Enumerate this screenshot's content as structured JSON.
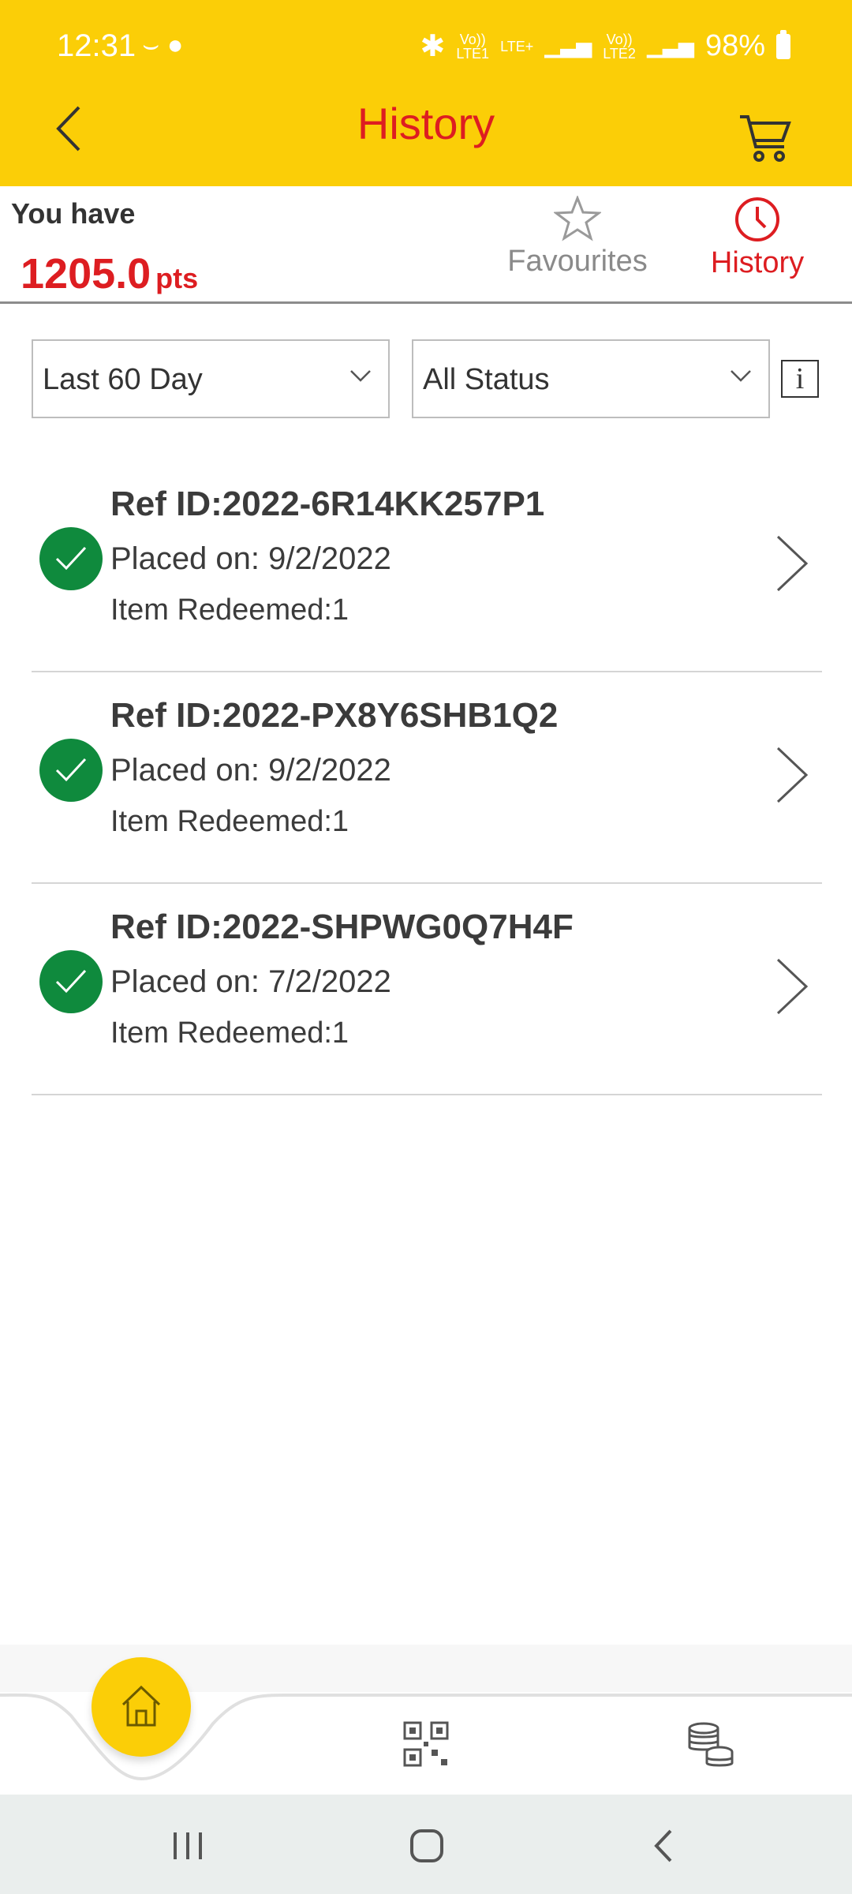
{
  "status_bar": {
    "time": "12:31",
    "net_left_top": "Vo))",
    "net_left_bottom": "LTE1",
    "net_lte": "LTE+",
    "net_right_top": "Vo))",
    "net_right_bottom": "LTE2",
    "battery": "98%"
  },
  "header": {
    "title": "History"
  },
  "account": {
    "you_have": "You have",
    "points": "1205.0",
    "points_unit": "pts"
  },
  "tabs": {
    "favourites": "Favourites",
    "history": "History"
  },
  "filters": {
    "period": "Last 60 Day",
    "status": "All Status",
    "info": "i"
  },
  "orders": [
    {
      "ref": "Ref ID:2022-6R14KK257P1",
      "placed": "Placed on: 9/2/2022",
      "items": "Item Redeemed:1"
    },
    {
      "ref": "Ref ID:2022-PX8Y6SHB1Q2",
      "placed": "Placed on: 9/2/2022",
      "items": "Item Redeemed:1"
    },
    {
      "ref": "Ref ID:2022-SHPWG0Q7H4F",
      "placed": "Placed on: 7/2/2022",
      "items": "Item Redeemed:1"
    }
  ],
  "colors": {
    "brand_yellow": "#FBCE07",
    "brand_red": "#DD1D21",
    "success_green": "#0F8A3D"
  },
  "icons": [
    "back-icon",
    "cart-icon",
    "star-icon",
    "clock-icon",
    "chevron-down-icon",
    "info-icon",
    "check-icon",
    "chevron-right-icon",
    "home-icon",
    "qr-code-icon",
    "coins-icon"
  ]
}
